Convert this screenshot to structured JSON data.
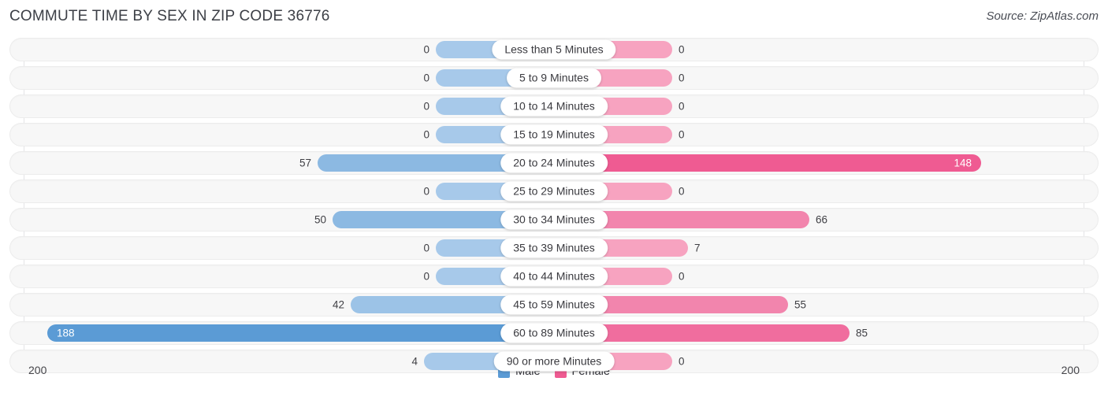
{
  "header": {
    "title": "COMMUTE TIME BY SEX IN ZIP CODE 36776",
    "source": "Source: ZipAtlas.com"
  },
  "axis": {
    "left_label": "200",
    "right_label": "200"
  },
  "legend": {
    "items": [
      {
        "label": "Male",
        "color": "#5b9bd5"
      },
      {
        "label": "Female",
        "color": "#ef5b92"
      }
    ]
  },
  "chart_data": {
    "type": "bar",
    "orientation": "horizontal-diverging",
    "title": "COMMUTE TIME BY SEX IN ZIP CODE 36776",
    "xlabel": "",
    "ylabel": "",
    "xlim": [
      200,
      200
    ],
    "axis_max": 200,
    "grid": true,
    "legend_position": "bottom-center",
    "categories": [
      "Less than 5 Minutes",
      "5 to 9 Minutes",
      "10 to 14 Minutes",
      "15 to 19 Minutes",
      "20 to 24 Minutes",
      "25 to 29 Minutes",
      "30 to 34 Minutes",
      "35 to 39 Minutes",
      "40 to 44 Minutes",
      "45 to 59 Minutes",
      "60 to 89 Minutes",
      "90 or more Minutes"
    ],
    "series": [
      {
        "name": "Male",
        "values": [
          0,
          0,
          0,
          0,
          57,
          0,
          50,
          0,
          0,
          42,
          188,
          4
        ]
      },
      {
        "name": "Female",
        "values": [
          0,
          0,
          0,
          0,
          148,
          0,
          66,
          7,
          0,
          55,
          85,
          0
        ]
      }
    ]
  },
  "rows": [
    {
      "category": "Less than 5 Minutes",
      "male": "0",
      "female": "0",
      "male_w": 150,
      "female_w": 150,
      "male_color": "#a7c9ea",
      "female_color": "#f7a3c0",
      "male_inside": false,
      "female_inside": false
    },
    {
      "category": "5 to 9 Minutes",
      "male": "0",
      "female": "0",
      "male_w": 150,
      "female_w": 150,
      "male_color": "#a7c9ea",
      "female_color": "#f7a3c0",
      "male_inside": false,
      "female_inside": false
    },
    {
      "category": "10 to 14 Minutes",
      "male": "0",
      "female": "0",
      "male_w": 150,
      "female_w": 150,
      "male_color": "#a7c9ea",
      "female_color": "#f7a3c0",
      "male_inside": false,
      "female_inside": false
    },
    {
      "category": "15 to 19 Minutes",
      "male": "0",
      "female": "0",
      "male_w": 150,
      "female_w": 150,
      "male_color": "#a7c9ea",
      "female_color": "#f7a3c0",
      "male_inside": false,
      "female_inside": false
    },
    {
      "category": "20 to 24 Minutes",
      "male": "57",
      "female": "148",
      "male_w": 300,
      "female_w": 542,
      "male_color": "#8cb9e2",
      "female_color": "#ef5b92",
      "male_inside": false,
      "female_inside": true
    },
    {
      "category": "25 to 29 Minutes",
      "male": "0",
      "female": "0",
      "male_w": 150,
      "female_w": 150,
      "male_color": "#a7c9ea",
      "female_color": "#f7a3c0",
      "male_inside": false,
      "female_inside": false
    },
    {
      "category": "30 to 34 Minutes",
      "male": "50",
      "female": "66",
      "male_w": 281,
      "female_w": 324,
      "male_color": "#8cb9e2",
      "female_color": "#f285ad",
      "male_inside": false,
      "female_inside": false
    },
    {
      "category": "35 to 39 Minutes",
      "male": "0",
      "female": "7",
      "male_w": 150,
      "female_w": 170,
      "male_color": "#a7c9ea",
      "female_color": "#f7a3c0",
      "male_inside": false,
      "female_inside": false
    },
    {
      "category": "40 to 44 Minutes",
      "male": "0",
      "female": "0",
      "male_w": 150,
      "female_w": 150,
      "male_color": "#a7c9ea",
      "female_color": "#f7a3c0",
      "male_inside": false,
      "female_inside": false
    },
    {
      "category": "45 to 59 Minutes",
      "male": "42",
      "female": "55",
      "male_w": 258,
      "female_w": 297,
      "male_color": "#9cc3e7",
      "female_color": "#f285ad",
      "male_inside": false,
      "female_inside": false
    },
    {
      "category": "60 to 89 Minutes",
      "male": "188",
      "female": "85",
      "male_w": 643,
      "female_w": 375,
      "male_color": "#5b9bd5",
      "female_color": "#f06d9e",
      "male_inside": true,
      "female_inside": false
    },
    {
      "category": "90 or more Minutes",
      "male": "4",
      "female": "0",
      "male_w": 165,
      "female_w": 150,
      "male_color": "#a7c9ea",
      "female_color": "#f7a3c0",
      "male_inside": false,
      "female_inside": false
    }
  ]
}
